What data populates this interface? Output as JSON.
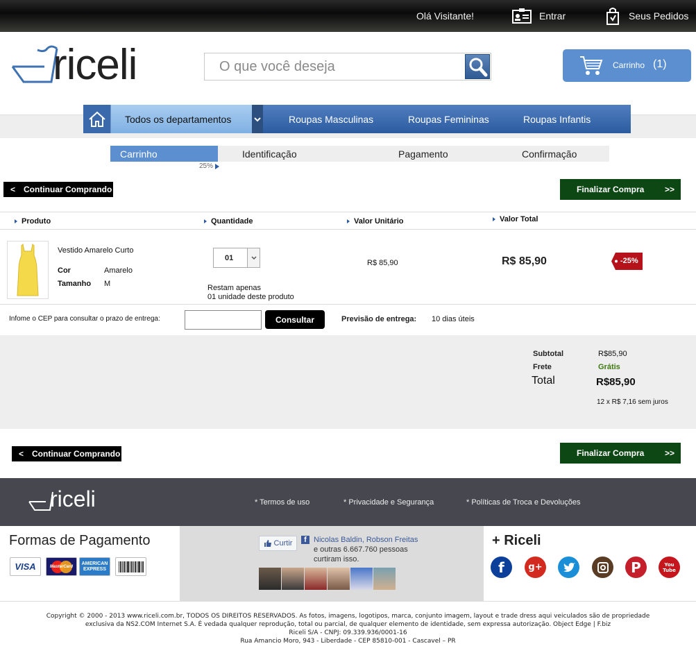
{
  "topbar": {
    "greeting": "Olá Visitante!",
    "login_label": "Entrar",
    "orders_label": "Seus Pedidos"
  },
  "header": {
    "logo_text": "riceli",
    "search_placeholder": "O que você deseja",
    "cart_label": "Carrinho",
    "cart_count": "(1)"
  },
  "nav": {
    "items": [
      "Todos os departamentos",
      "Roupas Masculinas",
      "Roupas Femininas",
      "Roupas Infantis"
    ]
  },
  "steps": {
    "items": [
      "Carrinho",
      "Identificação",
      "Pagamento",
      "Confirmação"
    ],
    "progress_label": "25%",
    "progress": 0.25
  },
  "actions": {
    "continue_label": "Continuar Comprando",
    "finish_label": "Finalizar Compra"
  },
  "table": {
    "headers": [
      "Produto",
      "Quantidade",
      "Valor Unitário",
      "Valor Total"
    ],
    "item": {
      "name": "Vestido Amarelo Curto",
      "color_label": "Cor",
      "color_value": "Amarelo",
      "size_label": "Tamanho",
      "size_value": "M",
      "quantity": "01",
      "stock_line1": "Restam apenas",
      "stock_line2": "01 unidade deste produto",
      "unit_price": "R$ 85,90",
      "total_price": "R$ 85,90",
      "discount_badge": "-25%"
    }
  },
  "shipping": {
    "prompt": "Infome o CEP para consultar o prazo de entrega:",
    "button_label": "Consultar",
    "forecast_label": "Previsão de entrega:",
    "forecast_value": "10 dias úteis"
  },
  "totals": {
    "subtotal_label": "Subtotal",
    "subtotal_value": "R$85,90",
    "freight_label": "Frete",
    "freight_value": "Grátis",
    "total_label": "Total",
    "total_value": "R$85,90",
    "installments": "12 x R$ 7,16 sem juros"
  },
  "footer": {
    "logo_text": "riceli",
    "links": [
      "* Termos de uso",
      "* Privacidade e Segurança",
      "* Políticas de Troca e Devoluções"
    ],
    "payments_title": "Formas de Pagamento",
    "cards": [
      "VISA",
      "MasterCard",
      "AMERICAN EXPRESS"
    ],
    "facebook": {
      "like_label": "Curtir",
      "names": "Nicolas Baldin, Robson Freitas",
      "others_line1": "e outras 6.667.760 pessoas",
      "others_line2": "curtiram isso."
    },
    "social_title": "+ Riceli",
    "social_icons": [
      "f",
      "g+",
      "twitter",
      "instagram",
      "P",
      "You Tube"
    ]
  },
  "copyright": {
    "line1": "Copyright © 2000 - 2013 www.riceli.com.br, TODOS OS DIREITOS RESERVADOS. As fotos, imagens, logotipos, marca, conjunto imagem, layout e trade dress aqui veiculados são de propriedade",
    "line2": "exclusiva da NS2.COM Internet S.A. É vedada qualquer reprodução, total ou parcial, de qualquer elemento de identidade, sem expressa autorização. Object Edge | F.biz",
    "line3": "Riceli S/A - CNPJ: 09.339.936/0001-16",
    "line4": "Rua Amancio Moro, 943 - Liberdade - CEP 85810-001 - Cascavel – PR"
  },
  "colors": {
    "accent_blue": "#5b8fd0",
    "nav_blue": "#2d5ba0",
    "finish_green": "#0d4714",
    "badge_red": "#b5121b",
    "free_green": "#3d7a12"
  }
}
